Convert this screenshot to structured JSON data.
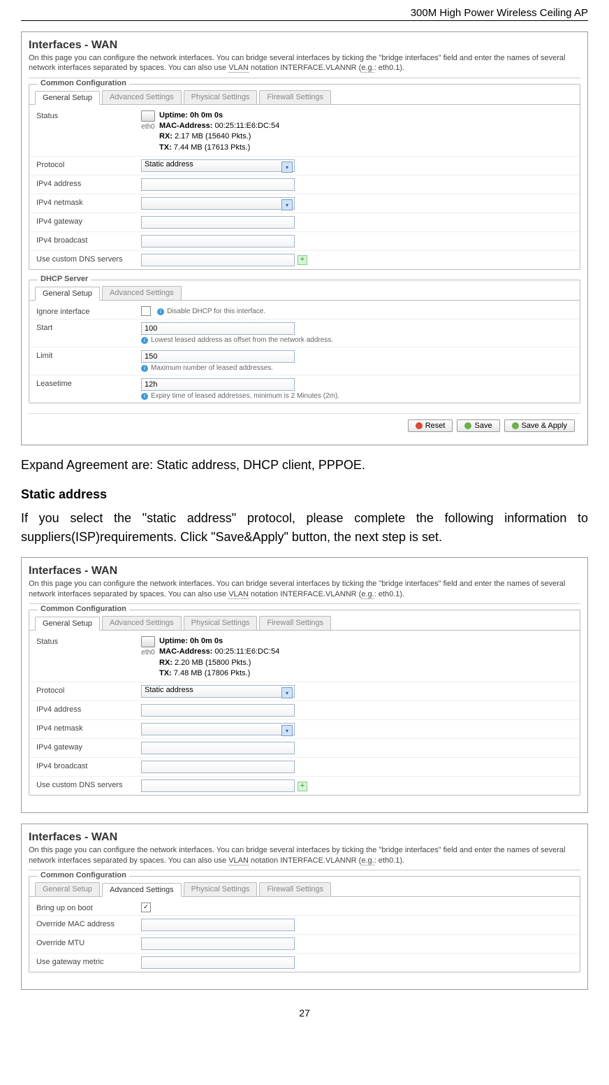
{
  "header": {
    "title": "300M High Power Wireless Ceiling AP"
  },
  "footer": {
    "page": "27"
  },
  "text": {
    "expand": "Expand Agreement are: Static address, DHCP client, PPPOE.",
    "static_heading": "Static address",
    "static_body": "If you select the \"static address\" protocol, please complete the following information to suppliers(ISP)requirements. Click \"Save&Apply\" button, the next step is set."
  },
  "panel1": {
    "title": "Interfaces - WAN",
    "desc_a": "On this page you can configure the network interfaces. You can bridge several interfaces by ticking the \"bridge interfaces\" field and enter the names of several network interfaces separated by spaces. You can also use ",
    "vlan": "VLAN",
    "desc_b": " notation INTERFACE.VLANNR (",
    "eg": "e.g.",
    "desc_c": ": eth0.1).",
    "legend": "Common Configuration",
    "tabs": [
      "General Setup",
      "Advanced Settings",
      "Physical Settings",
      "Firewall Settings"
    ],
    "rows": {
      "status_label": "Status",
      "eth": "eth0",
      "uptime": "Uptime: 0h 0m 0s",
      "mac_label": "MAC-Address:",
      "mac": " 00:25:11:E6:DC:54",
      "rx_label": "RX:",
      "rx": " 2.17 MB (15640 Pkts.)",
      "tx_label": "TX:",
      "tx": " 7.44 MB (17613 Pkts.)",
      "protocol": "Protocol",
      "protocol_val": "Static address",
      "ipv4addr": "IPv4 address",
      "ipv4mask": "IPv4 netmask",
      "ipv4gw": "IPv4 gateway",
      "ipv4bc": "IPv4 broadcast",
      "dns": "Use custom DNS servers"
    },
    "dhcp": {
      "legend": "DHCP Server",
      "tabs": [
        "General Setup",
        "Advanced Settings"
      ],
      "ignore": "Ignore interface",
      "ignore_hint": "Disable DHCP for this interface.",
      "start": "Start",
      "start_val": "100",
      "start_hint": "Lowest leased address as offset from the network address.",
      "limit": "Limit",
      "limit_val": "150",
      "limit_hint": "Maximum number of leased addresses.",
      "lease": "Leasetime",
      "lease_val": "12h",
      "lease_hint": "Expiry time of leased addresses, minimum is 2 Minutes (2m)."
    },
    "buttons": {
      "reset": "Reset",
      "save": "Save",
      "saveapply": "Save & Apply"
    }
  },
  "panel2": {
    "title": "Interfaces - WAN",
    "rows": {
      "uptime": "Uptime: 0h 0m 0s",
      "mac": " 00:25:11:E6:DC:54",
      "rx": " 2.20 MB (15800 Pkts.)",
      "tx": " 7.48 MB (17806 Pkts.)"
    }
  },
  "panel3": {
    "tabs": [
      "General Setup",
      "Advanced Settings",
      "Physical Settings",
      "Firewall Settings"
    ],
    "rows": {
      "boot": "Bring up on boot",
      "mac": "Override MAC address",
      "mtu": "Override MTU",
      "gw": "Use gateway metric"
    }
  }
}
